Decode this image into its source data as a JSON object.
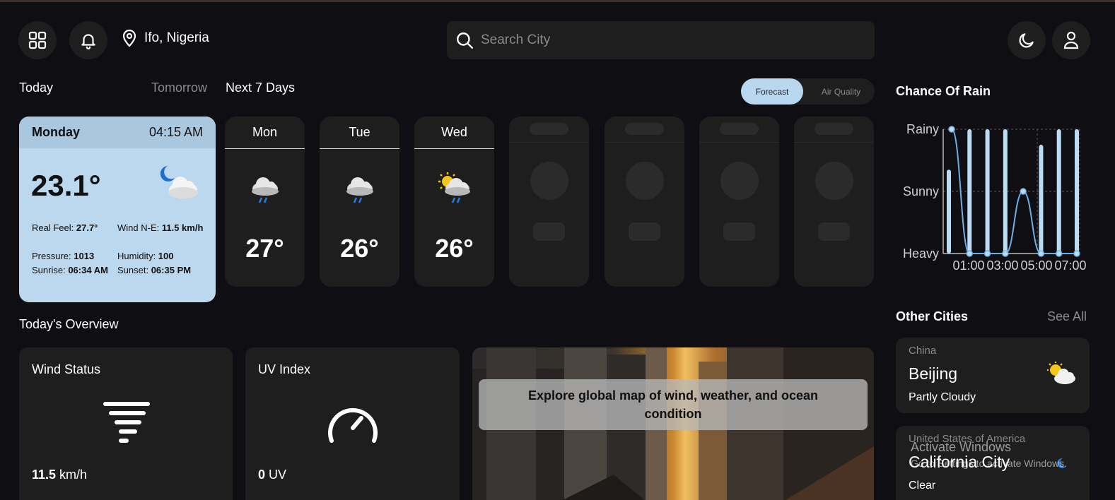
{
  "header": {
    "location": "Ifo, Nigeria",
    "search_placeholder": "Search City"
  },
  "tabs": {
    "today": "Today",
    "tomorrow": "Tomorrow",
    "next7": "Next 7 Days"
  },
  "toggle": {
    "forecast": "Forecast",
    "air_quality": "Air Quality"
  },
  "today_card": {
    "day": "Monday",
    "time": "04:15 AM",
    "temp": "23.1°",
    "real_feel_label": "Real Feel: ",
    "real_feel": "27.7°",
    "wind_label": "Wind N-E: ",
    "wind": "11.5 km/h",
    "pressure_label": "Pressure: ",
    "pressure": "1013",
    "humidity_label": "Humidity: ",
    "humidity": "100",
    "sunrise_label": "Sunrise: ",
    "sunrise": "06:34 AM",
    "sunset_label": "Sunset: ",
    "sunset": "06:35 PM"
  },
  "days": [
    {
      "name": "Mon",
      "temp": "27°",
      "icon": "rain-cloud-icon"
    },
    {
      "name": "Tue",
      "temp": "26°",
      "icon": "rain-cloud-icon"
    },
    {
      "name": "Wed",
      "temp": "26°",
      "icon": "sun-rain-cloud-icon"
    }
  ],
  "overview": {
    "title": "Today's Overview",
    "wind": {
      "title": "Wind Status",
      "value": "11.5",
      "unit": " km/h"
    },
    "uv": {
      "title": "UV Index",
      "value": "0",
      "unit": " UV"
    },
    "map_message": "Explore global map of wind, weather, and ocean condition"
  },
  "chart_data": {
    "type": "line",
    "title": "Chance Of Rain",
    "y_categories": [
      "Heavy",
      "Sunny",
      "Rainy"
    ],
    "x_tick_labels": [
      "01:00",
      "03:00",
      "05:00",
      "07:00"
    ],
    "x": [
      0,
      1,
      2,
      3,
      4,
      5,
      6,
      7
    ],
    "bars": [
      1.35,
      2,
      2,
      2,
      0,
      1.75,
      2,
      2
    ],
    "line": [
      2,
      0,
      0,
      0,
      1,
      0,
      0,
      0
    ],
    "grid": true
  },
  "other_cities": {
    "title": "Other Cities",
    "see_all": "See All",
    "cities": [
      {
        "country": "China",
        "name": "Beijing",
        "condition": "Partly Cloudy",
        "icon": "sun-cloud-icon"
      },
      {
        "country": "United States of America",
        "name": "California City",
        "condition": "Clear",
        "icon": "moon-icon"
      }
    ]
  },
  "watermark": {
    "line1": "Activate Windows",
    "line2": "Go to Settings to activate Windows."
  },
  "colors": {
    "background": "#0f0f13",
    "card": "#1e1e1e",
    "accent": "#bcd8ee"
  }
}
